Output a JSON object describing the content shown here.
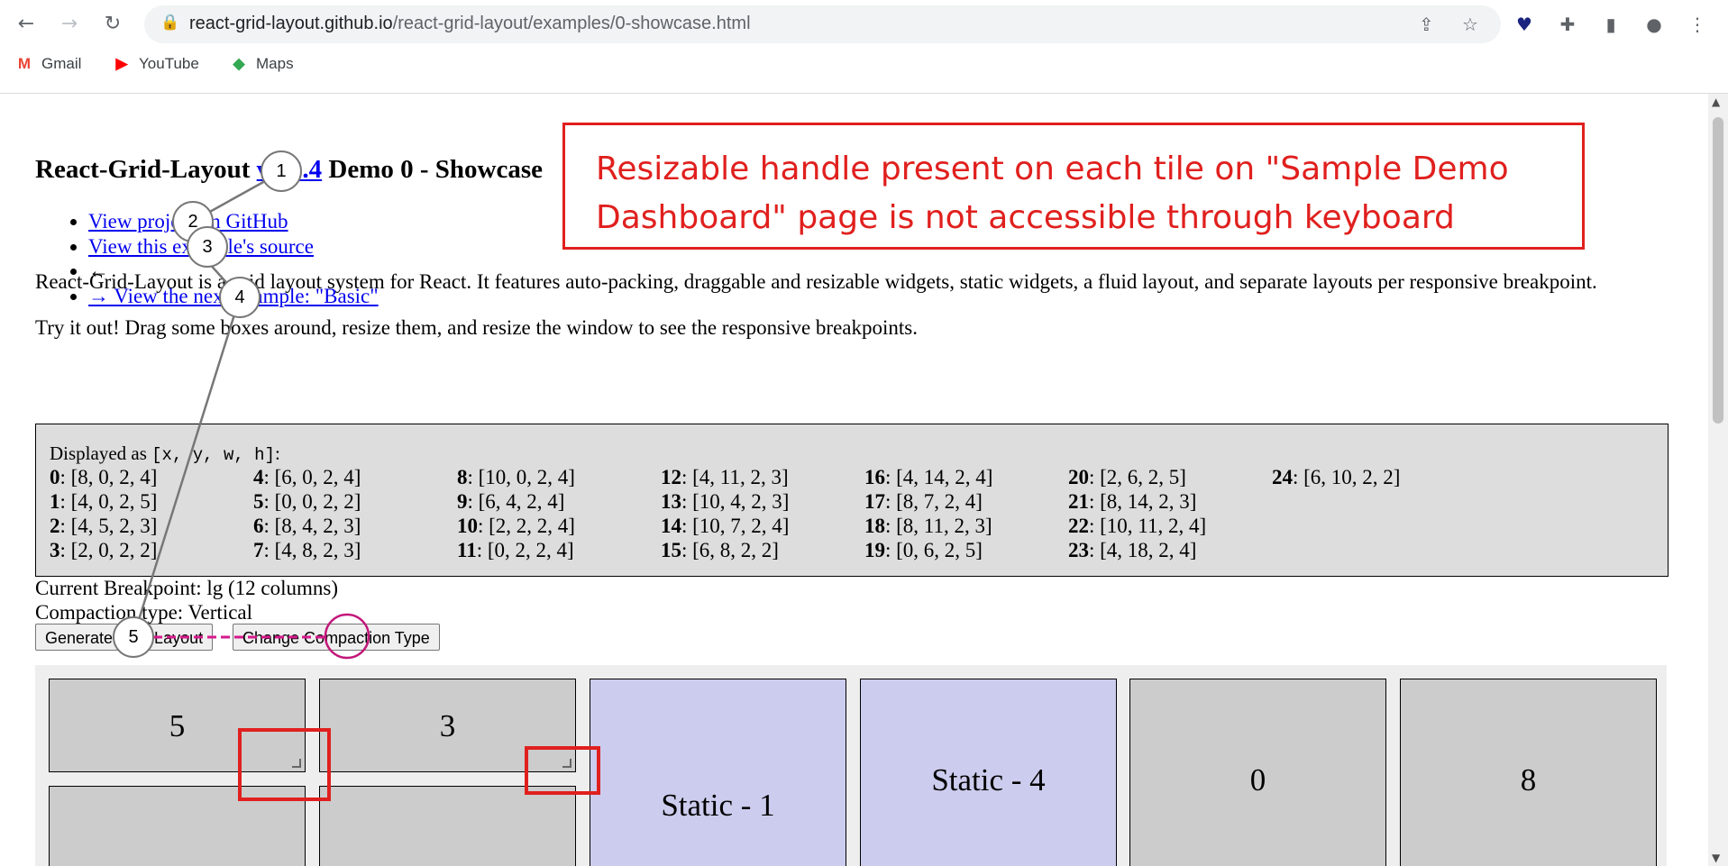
{
  "browser": {
    "url_host": "react-grid-layout.github.io",
    "url_path": "/react-grid-layout/examples/0-showcase.html",
    "bookmarks": [
      "Gmail",
      "YouTube",
      "Maps"
    ]
  },
  "page": {
    "title_prefix": "React-Grid-Layout ",
    "title_link": "v1.3.4",
    "title_suffix": " Demo 0 - Showcase",
    "links": [
      "View project on GitHub",
      "View this example's source",
      "←",
      "→ View the next example: \"Basic\""
    ],
    "intro1": "React-Grid-Layout is a grid layout system for React. It features auto-packing, draggable and resizable widgets, static widgets, a fluid layout, and separate layouts per responsive breakpoint.",
    "intro2": "Try it out! Drag some boxes around, resize them, and resize the window to see the responsive breakpoints.",
    "displayed_as_label": "Displayed as ",
    "displayed_as_code": "[x, y, w, h]",
    "displayed_as_colon": ":",
    "layout_items": [
      {
        "id": "0",
        "val": ": [8, 0, 2, 4]"
      },
      {
        "id": "1",
        "val": ": [4, 0, 2, 5]"
      },
      {
        "id": "2",
        "val": ": [4, 5, 2, 3]"
      },
      {
        "id": "3",
        "val": ": [2, 0, 2, 2]"
      },
      {
        "id": "4",
        "val": ": [6, 0, 2, 4]"
      },
      {
        "id": "5",
        "val": ": [0, 0, 2, 2]"
      },
      {
        "id": "6",
        "val": ": [8, 4, 2, 3]"
      },
      {
        "id": "7",
        "val": ": [4, 8, 2, 3]"
      },
      {
        "id": "8",
        "val": ": [10, 0, 2, 4]"
      },
      {
        "id": "9",
        "val": ": [6, 4, 2, 4]"
      },
      {
        "id": "10",
        "val": ": [2, 2, 2, 4]"
      },
      {
        "id": "11",
        "val": ": [0, 2, 2, 4]"
      },
      {
        "id": "12",
        "val": ": [4, 11, 2, 3]"
      },
      {
        "id": "13",
        "val": ": [10, 4, 2, 3]"
      },
      {
        "id": "14",
        "val": ": [10, 7, 2, 4]"
      },
      {
        "id": "15",
        "val": ": [6, 8, 2, 2]"
      },
      {
        "id": "16",
        "val": ": [4, 14, 2, 4]"
      },
      {
        "id": "17",
        "val": ": [8, 7, 2, 4]"
      },
      {
        "id": "18",
        "val": ": [8, 11, 2, 3]"
      },
      {
        "id": "19",
        "val": ": [0, 6, 2, 5]"
      },
      {
        "id": "20",
        "val": ": [2, 6, 2, 5]"
      },
      {
        "id": "21",
        "val": ": [8, 14, 2, 3]"
      },
      {
        "id": "22",
        "val": ": [10, 11, 2, 4]"
      },
      {
        "id": "23",
        "val": ": [4, 18, 2, 4]"
      },
      {
        "id": "24",
        "val": ": [6, 10, 2, 2]"
      }
    ],
    "current_breakpoint": "Current Breakpoint: lg (12 columns)",
    "compaction_type": "Compaction type: Vertical",
    "generate_button": "Generate New Layout",
    "change_compaction_button": "Change Compaction Type",
    "tiles": {
      "t5": "5",
      "t3": "3",
      "static1": "Static - 1",
      "static4": "Static - 4",
      "t0": "0",
      "t8": "8"
    }
  },
  "annotation": {
    "text": "Resizable handle present on each tile on \"Sample Demo Dashboard\" page is not accessible through keyboard",
    "markers": [
      "1",
      "2",
      "3",
      "4",
      "5"
    ],
    "color": "#e0201e"
  }
}
